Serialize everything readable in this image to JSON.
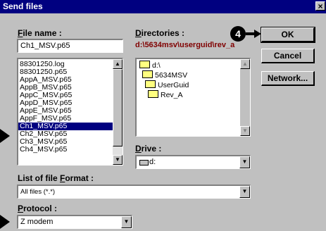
{
  "window": {
    "title": "Send files",
    "close_glyph": "×"
  },
  "file_name": {
    "label_u": "F",
    "label_rest": "ile name :",
    "value": "Ch1_MSV.p65"
  },
  "files": [
    {
      "name": "88301250.log",
      "selected": false
    },
    {
      "name": "88301250.p65",
      "selected": false
    },
    {
      "name": "AppA_MSV.p65",
      "selected": false
    },
    {
      "name": "AppB_MSV.p65",
      "selected": false
    },
    {
      "name": "AppC_MSV.p65",
      "selected": false
    },
    {
      "name": "AppD_MSV.p65",
      "selected": false
    },
    {
      "name": "AppE_MSV.p65",
      "selected": false
    },
    {
      "name": "AppF_MSV.p65",
      "selected": false
    },
    {
      "name": "Ch1_MSV.p65",
      "selected": true
    },
    {
      "name": "Ch2_MSV.p65",
      "selected": false
    },
    {
      "name": "Ch3_MSV.p65",
      "selected": false
    },
    {
      "name": "Ch4_MSV.p65",
      "selected": false
    }
  ],
  "directories": {
    "label_u": "D",
    "label_rest": "irectories :",
    "path": "d:\\5634msv\\userguid\\rev_a",
    "path_color": "#800000",
    "tree": [
      "d:\\",
      "5634MSV",
      "UserGuid",
      "Rev_A"
    ]
  },
  "drive": {
    "label_u": "D",
    "label_rest": "rive :",
    "value": "d:"
  },
  "file_format": {
    "label_pre": "List of file ",
    "label_u": "F",
    "label_rest": "ormat :",
    "value": "All files (*.*)"
  },
  "protocol": {
    "label_u": "P",
    "label_rest": "rotocol :",
    "value": "Z modem"
  },
  "buttons": {
    "ok": "OK",
    "cancel": "Cancel",
    "network": "Network..."
  },
  "callout": {
    "number": "4"
  }
}
